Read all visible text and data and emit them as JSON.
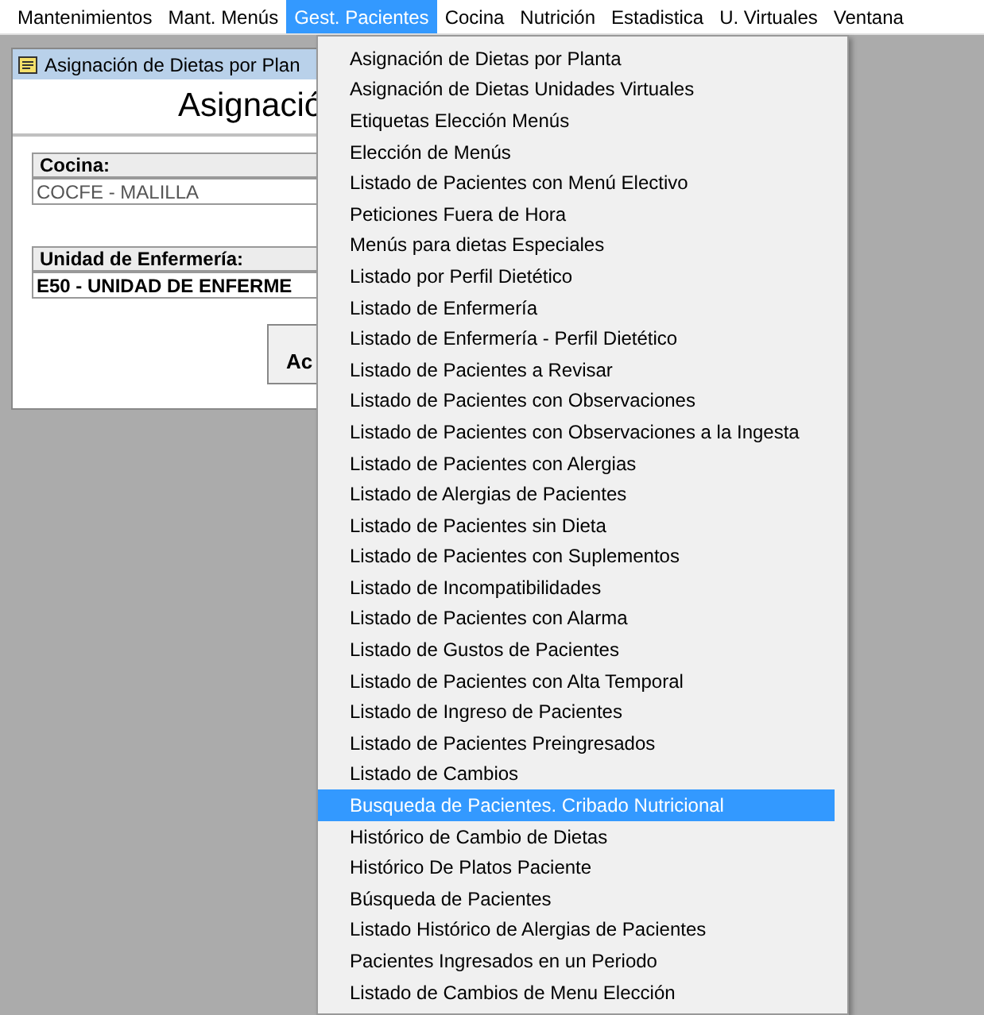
{
  "menu_bar": [
    {
      "label": "Mantenimientos",
      "selected": false
    },
    {
      "label": "Mant. Menús",
      "selected": false
    },
    {
      "label": "Gest. Pacientes",
      "selected": true
    },
    {
      "label": "Cocina",
      "selected": false
    },
    {
      "label": "Nutrición",
      "selected": false
    },
    {
      "label": "Estadistica",
      "selected": false
    },
    {
      "label": "U. Virtuales",
      "selected": false
    },
    {
      "label": "Ventana",
      "selected": false
    }
  ],
  "window": {
    "title": "Asignación de Dietas por Plan",
    "heading": "Asignació",
    "fields": [
      {
        "label": "Cocina:",
        "value": "COCFE - MALILLA",
        "bold": false
      },
      {
        "label": "Unidad de Enfermería:",
        "value": "E50 - UNIDAD DE ENFERME",
        "bold": true
      }
    ],
    "button": "Ac"
  },
  "dropdown": [
    {
      "label": "Asignación de Dietas por Planta",
      "selected": false
    },
    {
      "label": "Asignación de Dietas Unidades Virtuales",
      "selected": false
    },
    {
      "label": "Etiquetas Elección Menús",
      "selected": false
    },
    {
      "label": "Elección de Menús",
      "selected": false
    },
    {
      "label": "Listado de Pacientes con Menú Electivo",
      "selected": false
    },
    {
      "label": "Peticiones Fuera de Hora",
      "selected": false
    },
    {
      "label": "Menús para dietas Especiales",
      "selected": false
    },
    {
      "label": "Listado por Perfil Dietético",
      "selected": false
    },
    {
      "label": "Listado de Enfermería",
      "selected": false
    },
    {
      "label": "Listado de Enfermería - Perfil Dietético",
      "selected": false
    },
    {
      "label": "Listado de Pacientes a Revisar",
      "selected": false
    },
    {
      "label": "Listado de Pacientes con Observaciones",
      "selected": false
    },
    {
      "label": "Listado de Pacientes con Observaciones a la Ingesta",
      "selected": false
    },
    {
      "label": "Listado de Pacientes con Alergias",
      "selected": false
    },
    {
      "label": "Listado de Alergias de Pacientes",
      "selected": false
    },
    {
      "label": "Listado de Pacientes sin Dieta",
      "selected": false
    },
    {
      "label": "Listado de Pacientes con Suplementos",
      "selected": false
    },
    {
      "label": "Listado de Incompatibilidades",
      "selected": false
    },
    {
      "label": "Listado de Pacientes con Alarma",
      "selected": false
    },
    {
      "label": "Listado de Gustos de Pacientes",
      "selected": false
    },
    {
      "label": "Listado de Pacientes con Alta Temporal",
      "selected": false
    },
    {
      "label": "Listado de Ingreso de Pacientes",
      "selected": false
    },
    {
      "label": "Listado de Pacientes Preingresados",
      "selected": false
    },
    {
      "label": "Listado de Cambios",
      "selected": false
    },
    {
      "label": "Busqueda de Pacientes. Cribado Nutricional",
      "selected": true
    },
    {
      "label": "Histórico de Cambio de Dietas",
      "selected": false
    },
    {
      "label": "Histórico De Platos Paciente",
      "selected": false
    },
    {
      "label": "Búsqueda de Pacientes",
      "selected": false
    },
    {
      "label": "Listado Histórico de Alergias de Pacientes",
      "selected": false
    },
    {
      "label": "Pacientes Ingresados en un Periodo",
      "selected": false
    },
    {
      "label": "Listado de Cambios de Menu Elección",
      "selected": false
    }
  ]
}
